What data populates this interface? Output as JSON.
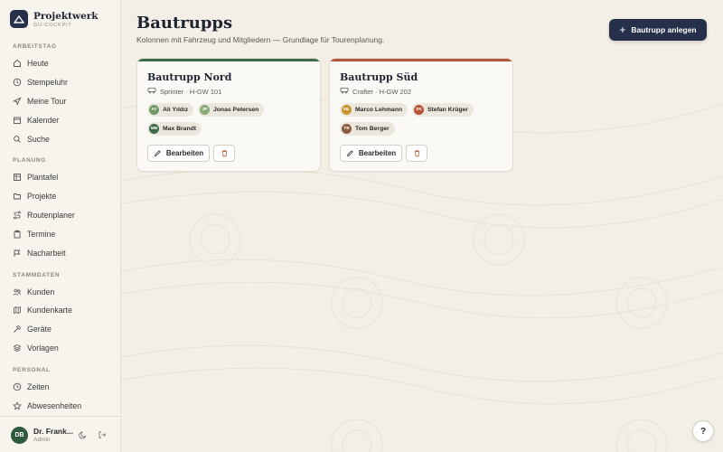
{
  "brand": {
    "name": "Projektwerk",
    "subtitle": "GU-COCKPIT"
  },
  "sidebar": {
    "sections": [
      {
        "label": "ARBEITSTAG",
        "items": [
          {
            "label": "Heute",
            "icon": "home-icon"
          },
          {
            "label": "Stempeluhr",
            "icon": "clock-icon"
          },
          {
            "label": "Meine Tour",
            "icon": "navigation-icon"
          },
          {
            "label": "Kalender",
            "icon": "calendar-icon"
          },
          {
            "label": "Suche",
            "icon": "search-icon"
          }
        ]
      },
      {
        "label": "PLANUNG",
        "items": [
          {
            "label": "Plantafel",
            "icon": "grid-icon"
          },
          {
            "label": "Projekte",
            "icon": "folder-icon"
          },
          {
            "label": "Routenplaner",
            "icon": "route-icon"
          },
          {
            "label": "Termine",
            "icon": "clipboard-icon"
          },
          {
            "label": "Nacharbeit",
            "icon": "flag-icon"
          }
        ]
      },
      {
        "label": "STAMMDATEN",
        "items": [
          {
            "label": "Kunden",
            "icon": "users-icon"
          },
          {
            "label": "Kundenkarte",
            "icon": "map-icon"
          },
          {
            "label": "Geräte",
            "icon": "hammer-icon"
          },
          {
            "label": "Vorlagen",
            "icon": "layers-icon"
          }
        ]
      },
      {
        "label": "PERSONAL",
        "items": [
          {
            "label": "Zeiten",
            "icon": "clock-icon"
          },
          {
            "label": "Abwesenheiten",
            "icon": "star-icon"
          }
        ]
      }
    ]
  },
  "user": {
    "initials": "DB",
    "name": "Dr. Frank...",
    "role": "Admin"
  },
  "page": {
    "title": "Bautrupps",
    "subtitle": "Kolonnen mit Fahrzeug und Mitgliedern — Grundlage für Tourenplanung.",
    "create_label": "Bautrupp anlegen"
  },
  "crews": [
    {
      "name": "Bautrupp Nord",
      "vehicle": "Sprinter · H-GW 101",
      "accent": "#3d6b4a",
      "members": [
        {
          "initials": "AY",
          "name": "Ali Yıldız",
          "color": "#6f9a6a"
        },
        {
          "initials": "JP",
          "name": "Jonas Petersen",
          "color": "#8aab78"
        },
        {
          "initials": "MB",
          "name": "Max Brandt",
          "color": "#3d6b4a"
        }
      ],
      "edit_label": "Bearbeiten"
    },
    {
      "name": "Bautrupp Süd",
      "vehicle": "Crafter · H-GW 202",
      "accent": "#b5553a",
      "members": [
        {
          "initials": "ML",
          "name": "Marco Lehmann",
          "color": "#c8962f"
        },
        {
          "initials": "SK",
          "name": "Stefan Krüger",
          "color": "#b5553a"
        },
        {
          "initials": "TB",
          "name": "Tom Berger",
          "color": "#8a5a3c"
        }
      ],
      "edit_label": "Bearbeiten"
    }
  ],
  "help_label": "?"
}
